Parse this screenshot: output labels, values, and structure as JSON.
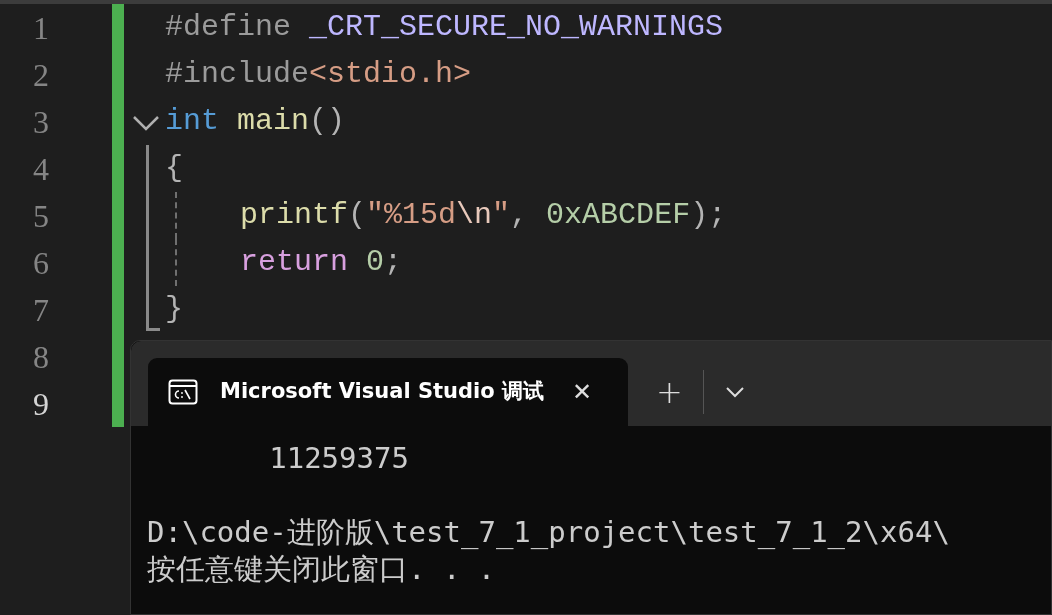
{
  "editor": {
    "lines": [
      {
        "number": "1",
        "current": false,
        "changed": true,
        "indented": false,
        "fold_start": false,
        "in_fold": false,
        "tokens": [
          {
            "text": "#define ",
            "kind": "preproc"
          },
          {
            "text": "_CRT_SECURE_NO_WARNINGS",
            "kind": "macro"
          }
        ]
      },
      {
        "number": "2",
        "current": false,
        "changed": true,
        "indented": false,
        "fold_start": false,
        "in_fold": false,
        "tokens": [
          {
            "text": "#include",
            "kind": "preproc"
          },
          {
            "text": "<stdio.h>",
            "kind": "string"
          }
        ]
      },
      {
        "number": "3",
        "current": false,
        "changed": true,
        "indented": false,
        "fold_start": true,
        "in_fold": false,
        "tokens": [
          {
            "text": "int ",
            "kind": "keyword"
          },
          {
            "text": "main",
            "kind": "function"
          },
          {
            "text": "()",
            "kind": "punct"
          }
        ]
      },
      {
        "number": "4",
        "current": false,
        "changed": true,
        "indented": false,
        "fold_start": false,
        "in_fold": true,
        "fold_end": false,
        "tokens": [
          {
            "text": "{",
            "kind": "punct"
          }
        ]
      },
      {
        "number": "5",
        "current": false,
        "changed": true,
        "indented": true,
        "fold_start": false,
        "in_fold": true,
        "fold_end": false,
        "tokens": [
          {
            "text": "printf",
            "kind": "function"
          },
          {
            "text": "(",
            "kind": "punct"
          },
          {
            "text": "\"%15d",
            "kind": "string"
          },
          {
            "text": "\\n",
            "kind": "escape"
          },
          {
            "text": "\"",
            "kind": "string"
          },
          {
            "text": ", ",
            "kind": "punct"
          },
          {
            "text": "0xABCDEF",
            "kind": "number"
          },
          {
            "text": ");",
            "kind": "punct"
          }
        ]
      },
      {
        "number": "6",
        "current": false,
        "changed": true,
        "indented": true,
        "fold_start": false,
        "in_fold": true,
        "fold_end": false,
        "tokens": [
          {
            "text": "return ",
            "kind": "control"
          },
          {
            "text": "0",
            "kind": "number"
          },
          {
            "text": ";",
            "kind": "punct"
          }
        ]
      },
      {
        "number": "7",
        "current": false,
        "changed": true,
        "indented": false,
        "fold_start": false,
        "in_fold": true,
        "fold_end": true,
        "tokens": [
          {
            "text": "}",
            "kind": "punct"
          }
        ]
      },
      {
        "number": "8",
        "current": false,
        "changed": true
      },
      {
        "number": "9",
        "current": true,
        "changed": true
      }
    ]
  },
  "terminal": {
    "tab": {
      "title": "Microsoft Visual Studio 调试",
      "selected": true,
      "close": "✕"
    },
    "new_tab": "+",
    "output": [
      {
        "lines": [
          "       11259375"
        ]
      },
      {
        "lines": [
          "D:\\code-进阶版\\test_7_1_project\\test_7_1_2\\x64\\",
          "按任意键关闭此窗口. . ."
        ]
      }
    ]
  }
}
